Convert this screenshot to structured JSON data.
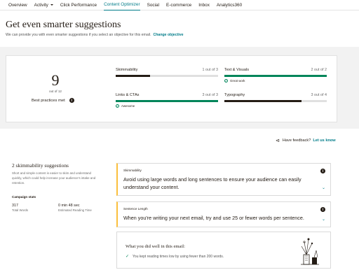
{
  "nav": {
    "items": [
      "Overview",
      "Activity",
      "Click Performance",
      "Content Optimizer",
      "Social",
      "E-commerce",
      "Inbox",
      "Analytics360"
    ],
    "active": "Content Optimizer"
  },
  "header": {
    "title": "Get even smarter suggestions",
    "subtitle": "We can provide you with even smarter suggestions if you select an objective for this email.",
    "link": "Change objective"
  },
  "score": {
    "value": "9",
    "out_of": "out of 12",
    "label": "Best practices met"
  },
  "metrics": [
    {
      "name": "Skimmability",
      "count": "1 out of 3",
      "fraction": 0.333,
      "status": "",
      "color": "#241c15"
    },
    {
      "name": "Text & Visuals",
      "count": "2 out of 2",
      "fraction": 1.0,
      "status": "Great work",
      "color": "#00855a"
    },
    {
      "name": "Links & CTAs",
      "count": "3 out of 3",
      "fraction": 1.0,
      "status": "Awesome",
      "color": "#00855a"
    },
    {
      "name": "Typography",
      "count": "3 out of 4",
      "fraction": 0.75,
      "status": "",
      "color": "#241c15"
    }
  ],
  "feedback": {
    "text": "Have feedback?",
    "link": "Let us know"
  },
  "suggestions_panel": {
    "title": "2 skimmability suggestions",
    "description": "Short and simple content is easier to skim and understand quickly, which could help increase your audience's intake and retention.",
    "stats_heading": "Campaign stats",
    "stats": [
      {
        "value": "317",
        "label": "Total Words"
      },
      {
        "value": "0 min 48 sec",
        "label": "Estimated Reading Time"
      }
    ]
  },
  "suggestion_cards": [
    {
      "kicker": "Skimmability",
      "text": "Avoid using large words and long sentences to ensure your audience can easily understand your content."
    },
    {
      "kicker": "Sentence Length",
      "text": "When you're writing your next email, try and use 25 or fewer words per sentence."
    }
  ],
  "well_done": {
    "title": "What you did well in this email:",
    "items": [
      "You kept reading times low by using fewer than 200 words."
    ]
  },
  "colors": {
    "accent": "#007c89",
    "success": "#00855a",
    "warning_border": "#fbbf3c",
    "band": "#f2f2f2"
  }
}
